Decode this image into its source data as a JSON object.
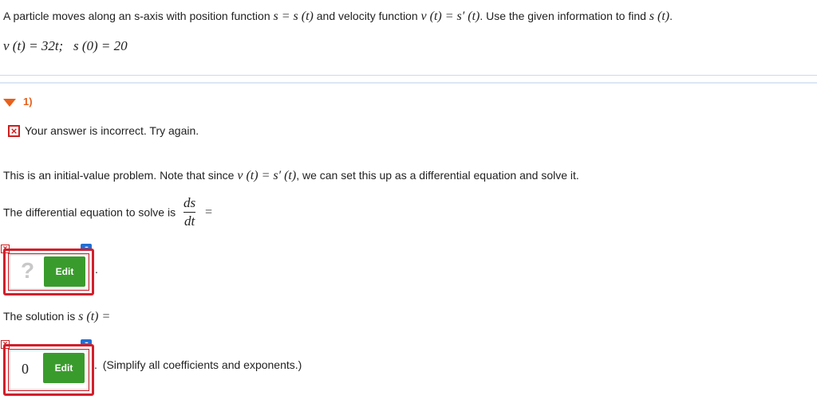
{
  "question": {
    "prefix": "A particle moves along an s-axis with position function",
    "pos_expr": "s = s (t)",
    "mid": "and velocity function",
    "vel_expr": "v (t) = s′ (t)",
    "suffix": ". Use the given information to find",
    "find_expr": "s (t)",
    "end": ".",
    "given": "v (t) = 32t;   s (0) = 20"
  },
  "part": {
    "number": "1)"
  },
  "feedback": {
    "message": "Your answer is incorrect. Try again."
  },
  "hint": {
    "prefix": "This is an initial-value problem. Note that since",
    "expr": "v (t) = s′ (t)",
    "suffix": ", we can set this up as a differential equation and solve it."
  },
  "diffeq": {
    "label": "The differential equation to solve is",
    "numerator": "ds",
    "denominator": "dt",
    "equals": "="
  },
  "answer1": {
    "value": "?",
    "edit_label": "Edit",
    "after": "."
  },
  "solution": {
    "label": "The solution is",
    "expr": "s (t) ="
  },
  "answer2": {
    "value": "0",
    "edit_label": "Edit",
    "after": ".",
    "note": "(Simplify all coefficients and exponents.)"
  },
  "icons": {
    "incorrect": "x-mark-icon",
    "chat": "chat-bubble-icon",
    "collapse": "triangle-down-icon"
  },
  "colors": {
    "accent": "#e8601c",
    "error": "#d21f2b",
    "edit_button": "#3a9b2d",
    "chat": "#1f6fd6"
  }
}
